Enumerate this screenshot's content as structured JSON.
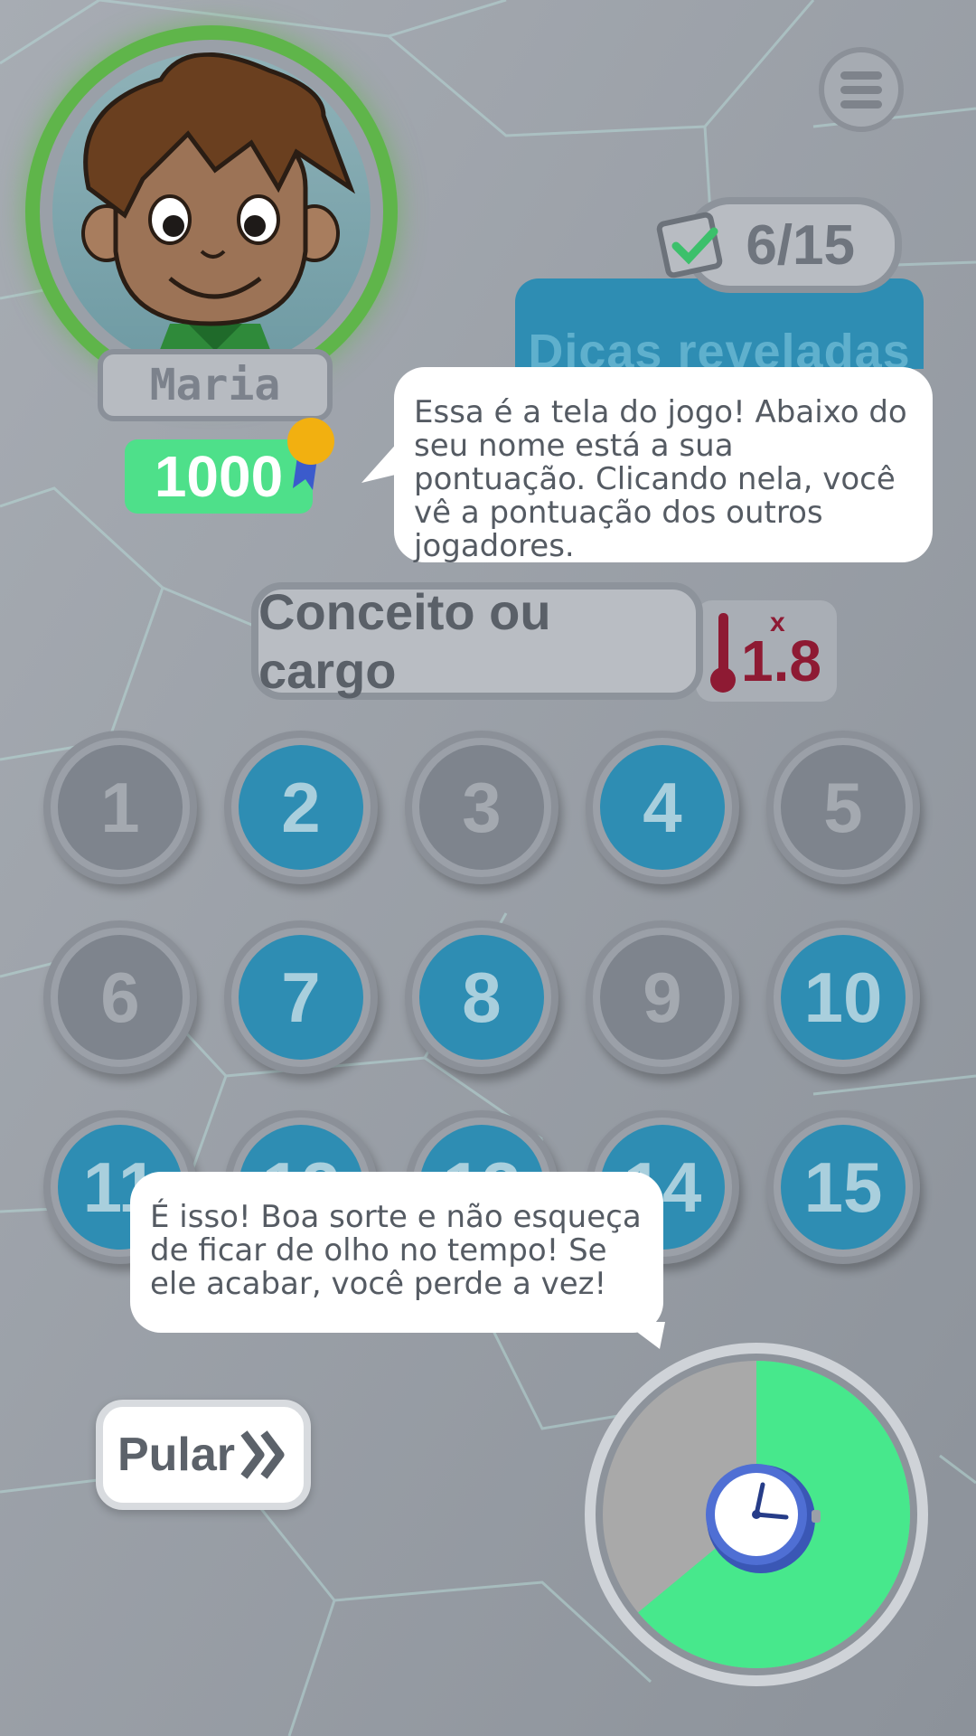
{
  "player": {
    "name": "Maria",
    "score": "1000"
  },
  "progress": {
    "counter": "6/15",
    "hints_label": "Dicas reveladas"
  },
  "tooltips": {
    "score_hint": "Essa é a tela do jogo! Abaixo do seu nome está a sua pontuação. Clicando nela, você vê a pontuação dos outros jogadores.",
    "timer_hint": "É isso! Boa sorte e não esqueça de ficar de olho no tempo! Se ele acabar, você perde a vez!"
  },
  "category": {
    "label": "Conceito ou cargo",
    "multiplier_x": "x",
    "multiplier_value": "1.8"
  },
  "hints": [
    {
      "label": "1",
      "state": "revealed"
    },
    {
      "label": "2",
      "state": "hidden"
    },
    {
      "label": "3",
      "state": "revealed"
    },
    {
      "label": "4",
      "state": "hidden"
    },
    {
      "label": "5",
      "state": "revealed"
    },
    {
      "label": "6",
      "state": "revealed"
    },
    {
      "label": "7",
      "state": "hidden"
    },
    {
      "label": "8",
      "state": "hidden"
    },
    {
      "label": "9",
      "state": "revealed"
    },
    {
      "label": "10",
      "state": "hidden"
    },
    {
      "label": "11",
      "state": "hidden"
    },
    {
      "label": "12",
      "state": "hidden"
    },
    {
      "label": "13",
      "state": "hidden"
    },
    {
      "label": "14",
      "state": "hidden"
    },
    {
      "label": "15",
      "state": "hidden"
    }
  ],
  "skip": {
    "label": "Pular"
  },
  "timer": {
    "remaining_fraction": 0.64,
    "remaining_color": "#47e88c",
    "elapsed_color": "#a9a9a9"
  },
  "icons": {
    "menu": "hamburger-menu-icon",
    "check": "checkmark-note-icon",
    "medal": "medal-icon",
    "thermometer": "thermometer-icon",
    "skip": "double-chevron-right-icon",
    "clock": "clock-icon"
  }
}
